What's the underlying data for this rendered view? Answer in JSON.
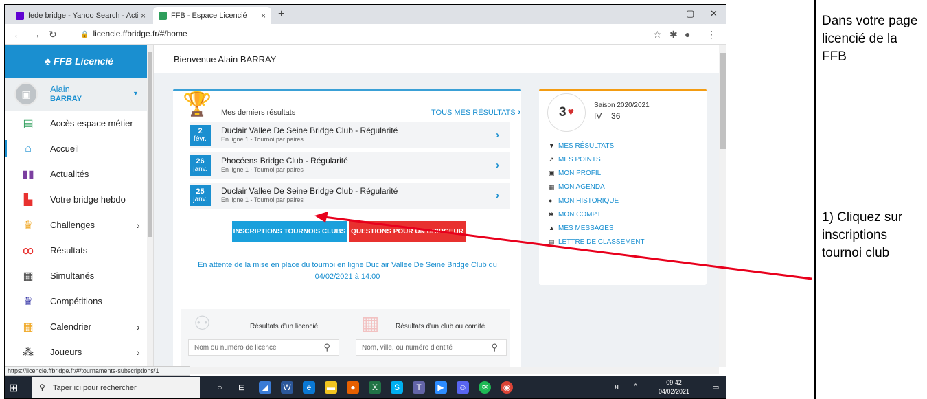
{
  "browser": {
    "tabs": [
      {
        "label": "fede bridge - Yahoo Search - Acti",
        "close": "×"
      },
      {
        "label": "FFB - Espace Licencié",
        "close": "×"
      }
    ],
    "new_tab": "+",
    "url": "licencie.ffbridge.fr/#/home",
    "status_url": "https://licencie.ffbridge.fr/#/tournaments-subscriptions/1"
  },
  "app": {
    "logo": "FFB Licencié",
    "user": {
      "first_name": "Alain",
      "last_name": "BARRAY"
    },
    "welcome": "Bienvenue Alain BARRAY"
  },
  "sidebar": {
    "items": [
      {
        "label": "Accès espace métier",
        "icon": "briefcase-icon"
      },
      {
        "label": "Accueil",
        "icon": "home-icon"
      },
      {
        "label": "Actualités",
        "icon": "book-icon"
      },
      {
        "label": "Votre bridge hebdo",
        "icon": "calendar-icon"
      },
      {
        "label": "Challenges",
        "icon": "trophy-icon"
      },
      {
        "label": "Résultats",
        "icon": "medal-icon"
      },
      {
        "label": "Simultanés",
        "icon": "grid-icon"
      },
      {
        "label": "Compétitions",
        "icon": "cup-icon"
      },
      {
        "label": "Calendrier",
        "icon": "calendar-icon"
      },
      {
        "label": "Joueurs",
        "icon": "users-icon"
      }
    ]
  },
  "results_card": {
    "title": "Mes derniers résultats",
    "all_link": "TOUS MES RÉSULTATS",
    "rows": [
      {
        "day": "2",
        "month": "févr.",
        "name": "Duclair Vallee De Seine Bridge Club - Régularité",
        "sub": "En ligne 1 - Tournoi par paires"
      },
      {
        "day": "26",
        "month": "janv.",
        "name": "Phocéens Bridge Club - Régularité",
        "sub": "En ligne 1 - Tournoi par paires"
      },
      {
        "day": "25",
        "month": "janv.",
        "name": "Duclair Vallee De Seine Bridge Club - Régularité",
        "sub": "En ligne 1 - Tournoi par paires"
      }
    ],
    "btn_inscriptions": "INSCRIPTIONS TOURNOIS CLUBS",
    "btn_questions": "QUESTIONS POUR UN BRIDGEUR",
    "waiting_text": "En attente de la mise en place du tournoi en ligne Duclair Vallee De Seine Bridge Club du 04/02/2021 à 14:00",
    "search_licencie_label": "Résultats d'un licencié",
    "search_licencie_placeholder": "Nom ou numéro de licence",
    "search_club_label": "Résultats d'un club ou comité",
    "search_club_placeholder": "Nom, ville, ou numéro d'entité"
  },
  "season_card": {
    "score": "3",
    "saison": "Saison 2020/2021",
    "iv": "IV = 36",
    "links": [
      {
        "label": "MES RÉSULTATS",
        "icon": "trophy-icon"
      },
      {
        "label": "MES POINTS",
        "icon": "chart-icon"
      },
      {
        "label": "MON PROFIL",
        "icon": "id-card-icon"
      },
      {
        "label": "MON AGENDA",
        "icon": "calendar-icon"
      },
      {
        "label": "MON HISTORIQUE",
        "icon": "clock-icon"
      },
      {
        "label": "MON COMPTE",
        "icon": "gear-icon"
      },
      {
        "label": "MES MESSAGES",
        "icon": "bell-icon"
      },
      {
        "label": "LETTRE DE CLASSEMENT",
        "icon": "document-icon"
      }
    ]
  },
  "taskbar": {
    "search_placeholder": "Taper ici pour rechercher",
    "time": "09:42",
    "date": "04/02/2021"
  },
  "annotations": {
    "note1": "Dans votre page licencié de la FFB",
    "note2": "1) Cliquez sur inscriptions tournoi club"
  },
  "colors": {
    "accent": "#1a8fd0",
    "danger": "#e8312f",
    "highlight_arrow": "#e8001c"
  }
}
